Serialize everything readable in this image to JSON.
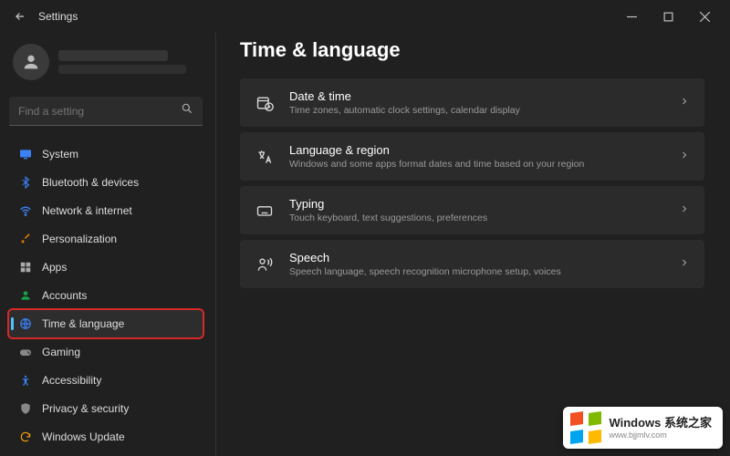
{
  "window": {
    "title": "Settings"
  },
  "search": {
    "placeholder": "Find a setting"
  },
  "sidebar": {
    "items": [
      {
        "label": "System"
      },
      {
        "label": "Bluetooth & devices"
      },
      {
        "label": "Network & internet"
      },
      {
        "label": "Personalization"
      },
      {
        "label": "Apps"
      },
      {
        "label": "Accounts"
      },
      {
        "label": "Time & language"
      },
      {
        "label": "Gaming"
      },
      {
        "label": "Accessibility"
      },
      {
        "label": "Privacy & security"
      },
      {
        "label": "Windows Update"
      }
    ]
  },
  "page": {
    "title": "Time & language",
    "cards": [
      {
        "title": "Date & time",
        "desc": "Time zones, automatic clock settings, calendar display"
      },
      {
        "title": "Language & region",
        "desc": "Windows and some apps format dates and time based on your region"
      },
      {
        "title": "Typing",
        "desc": "Touch keyboard, text suggestions, preferences"
      },
      {
        "title": "Speech",
        "desc": "Speech language, speech recognition microphone setup, voices"
      }
    ]
  },
  "watermark": {
    "title": "Windows 系统之家",
    "sub": "www.bjjmlv.com"
  }
}
